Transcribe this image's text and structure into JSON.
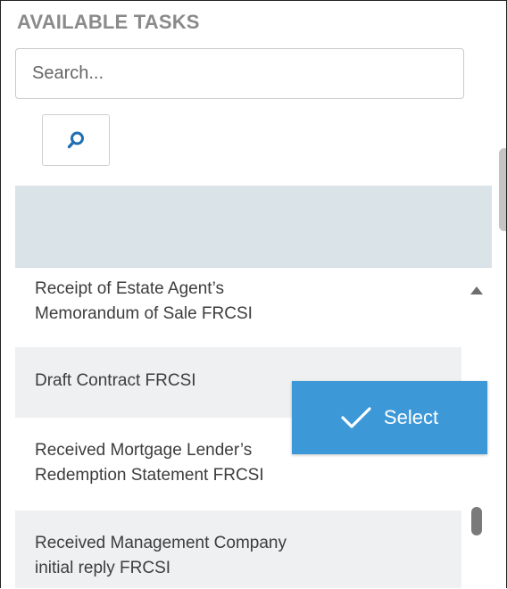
{
  "panel": {
    "title": "AVAILABLE TASKS"
  },
  "search": {
    "placeholder": "Search...",
    "value": "",
    "button_icon": "search-icon"
  },
  "tasks": [
    {
      "line1": "Receipt of Estate Agent’s",
      "line2": "Memorandum of Sale FRCSI"
    },
    {
      "line1": "Draft Contract FRCSI",
      "line2": ""
    },
    {
      "line1": "Received Mortgage Lender’s",
      "line2": "Redemption Statement FRCSI"
    },
    {
      "line1": "Received Management Company",
      "line2": "initial reply FRCSI"
    }
  ],
  "select_button": {
    "label": "Select",
    "icon": "check-icon",
    "color": "#3d98d8"
  },
  "colors": {
    "list_header": "#dae3e8",
    "row_alt": "#eef0f1",
    "search_icon": "#1f6fb3",
    "title": "#8a8a8a"
  }
}
